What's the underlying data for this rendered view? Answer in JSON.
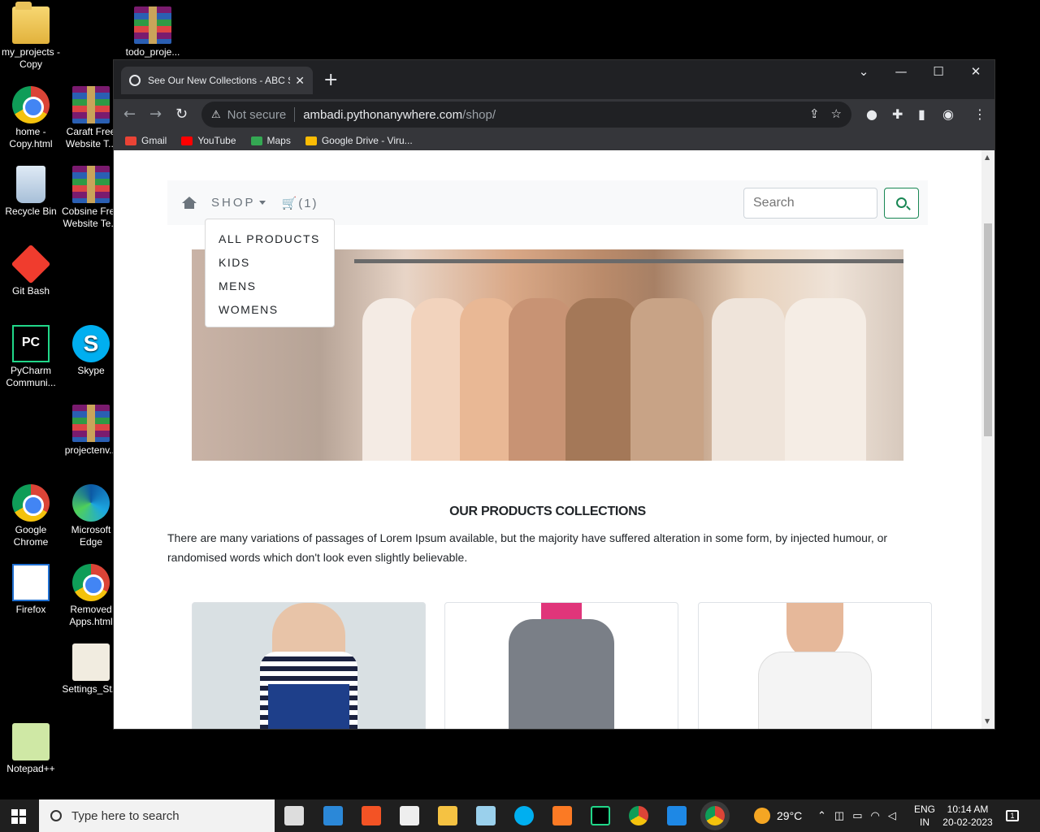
{
  "desktop": {
    "icons": [
      {
        "label": "my_projects - Copy"
      },
      {
        "label": "todo_proje..."
      },
      {
        "label": "home - Copy.html"
      },
      {
        "label": "Caraft Free Website T..."
      },
      {
        "label": "Recycle Bin"
      },
      {
        "label": "Cobsine Free Website Te..."
      },
      {
        "label": "Git Bash"
      },
      {
        "label": "PyCharm Communi..."
      },
      {
        "label": "Skype"
      },
      {
        "label": "projectenv..."
      },
      {
        "label": "Google Chrome"
      },
      {
        "label": "Microsoft Edge"
      },
      {
        "label": "Firefox"
      },
      {
        "label": "Removed Apps.html"
      },
      {
        "label": "Settings_St..."
      },
      {
        "label": "Notepad++"
      }
    ]
  },
  "browser": {
    "tab_title": "See Our New Collections - ABC S",
    "tab_close": "✕",
    "new_tab": "+",
    "window_controls": {
      "dropdown": "⌄",
      "minimize": "—",
      "maximize": "☐",
      "close": "✕"
    },
    "nav": {
      "back": "←",
      "forward": "→",
      "reload": "↻"
    },
    "omnibox": {
      "warning_icon": "⚠",
      "security": "Not secure",
      "host": "ambadi.pythonanywhere.com",
      "path": "/shop/"
    },
    "bookmarks": [
      {
        "label": "Gmail",
        "color": "#ea4335"
      },
      {
        "label": "YouTube",
        "color": "#ff0000"
      },
      {
        "label": "Maps",
        "color": "#34a853"
      },
      {
        "label": "Google Drive - Viru...",
        "color": "#fbbc04"
      }
    ]
  },
  "site": {
    "nav": {
      "shop": "SHOP",
      "cart": "(1)",
      "search_placeholder": "Search"
    },
    "dropdown": [
      "ALL PRODUCTS",
      "KIDS",
      "MENS",
      "WOMENS"
    ],
    "section_title": "OUR PRODUCTS COLLECTIONS",
    "section_text": "There are many variations of passages of Lorem Ipsum available, but the majority have suffered alteration in some form, by injected humour, or randomised words which don't look even slightly believable."
  },
  "taskbar": {
    "search_placeholder": "Type here to search",
    "weather": "29°C",
    "lang_line1": "ENG",
    "lang_line2": "IN",
    "time": "10:14 AM",
    "date": "20-02-2023",
    "notification_count": "1"
  },
  "colors": {
    "accent_green": "#198754",
    "chrome_dark": "#202124",
    "chrome_toolbar": "#35363a"
  }
}
